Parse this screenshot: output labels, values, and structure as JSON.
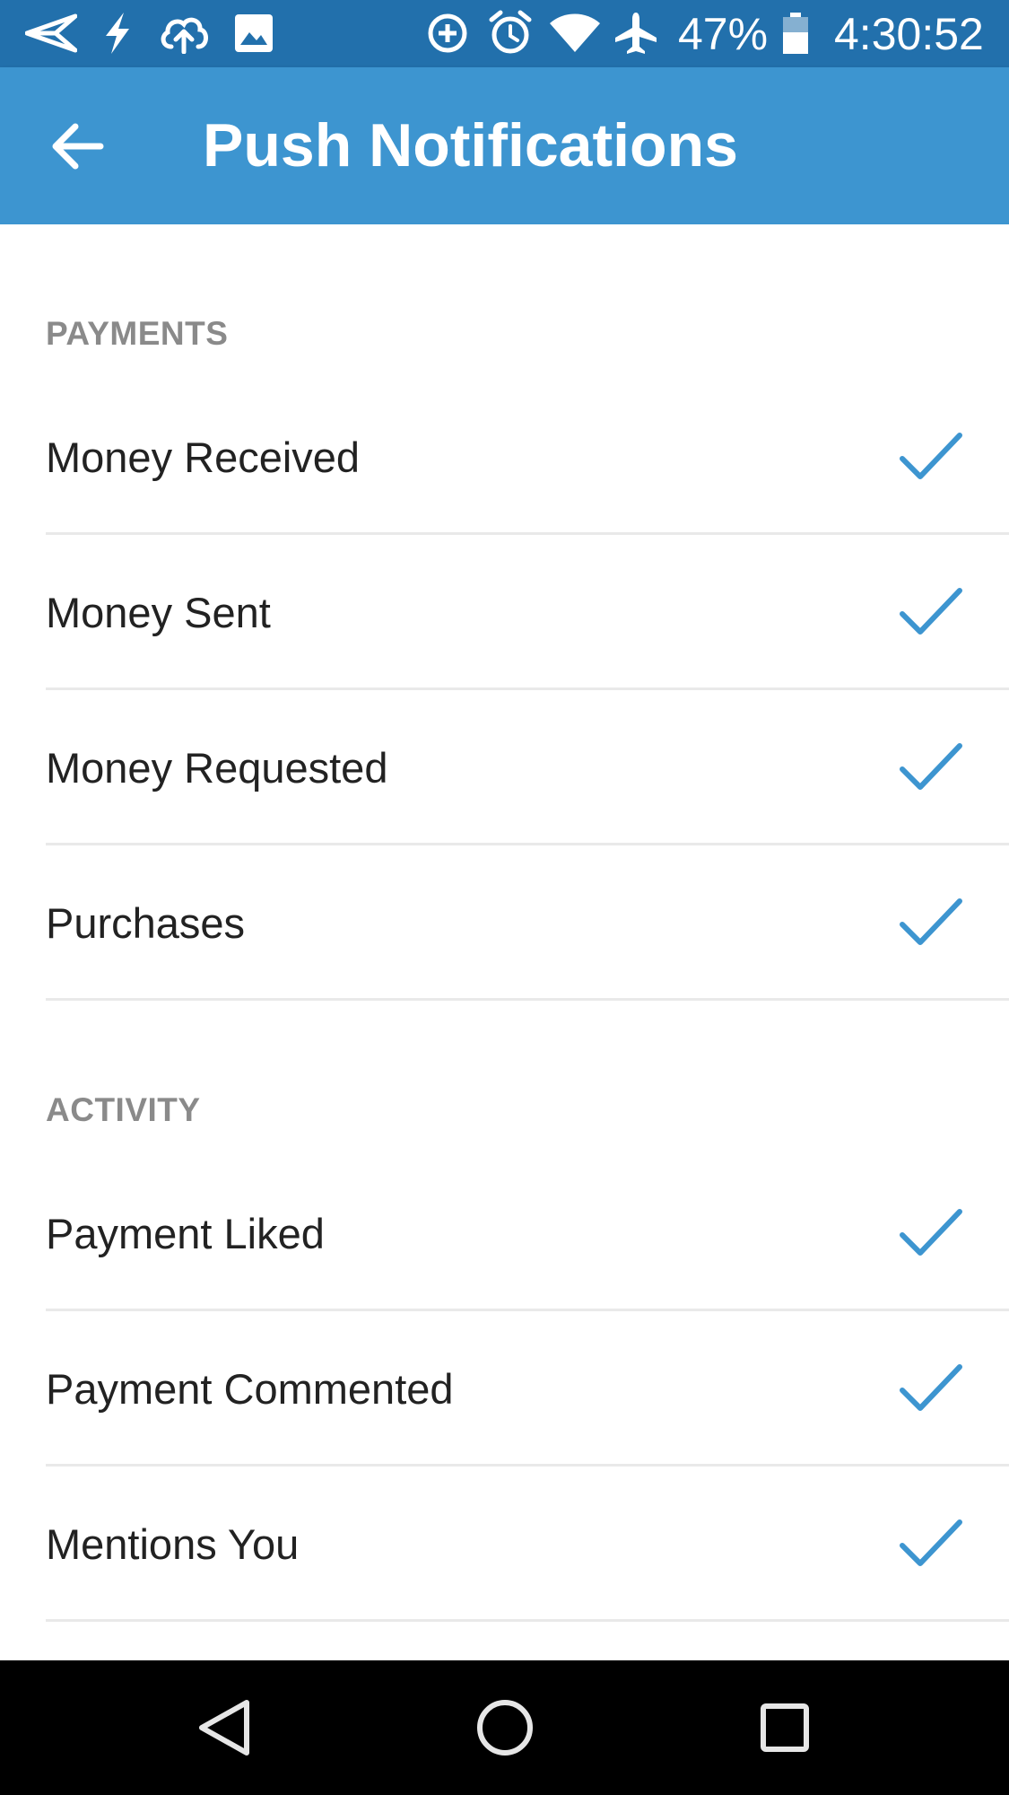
{
  "status_bar": {
    "battery": "47%",
    "time": "4:30:52",
    "icons": [
      "send-icon",
      "flash-icon",
      "cloud-upload-icon",
      "image-icon",
      "data-saver-icon",
      "alarm-icon",
      "wifi-icon",
      "airplane-mode-icon",
      "battery-icon"
    ]
  },
  "app_bar": {
    "title": "Push Notifications",
    "back_icon": "arrow-back-icon"
  },
  "sections": [
    {
      "header": "PAYMENTS",
      "items": [
        {
          "label": "Money Received",
          "checked": true
        },
        {
          "label": "Money Sent",
          "checked": true
        },
        {
          "label": "Money Requested",
          "checked": true
        },
        {
          "label": "Purchases",
          "checked": true
        }
      ]
    },
    {
      "header": "ACTIVITY",
      "items": [
        {
          "label": "Payment Liked",
          "checked": true
        },
        {
          "label": "Payment Commented",
          "checked": true
        },
        {
          "label": "Mentions You",
          "checked": true
        }
      ]
    }
  ],
  "nav_bar": {
    "icons": [
      "nav-back-icon",
      "nav-home-icon",
      "nav-recents-icon"
    ]
  },
  "colors": {
    "status_bar": "#2270ac",
    "app_bar": "#3d95d0",
    "accent": "#3d95d0",
    "section_header": "#8a8a8a",
    "item_text": "#222222",
    "divider": "#e9e9e9",
    "nav_bar": "#000000"
  }
}
